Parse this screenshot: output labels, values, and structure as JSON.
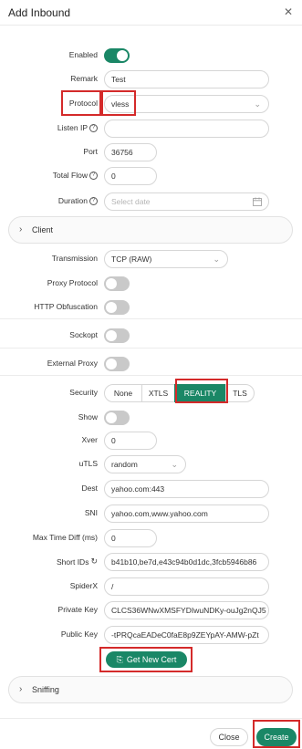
{
  "dialog": {
    "title": "Add Inbound",
    "close_icon": "close-icon"
  },
  "fields": {
    "enabled_label": "Enabled",
    "remark_label": "Remark",
    "remark_value": "Test",
    "protocol_label": "Protocol",
    "protocol_value": "vless",
    "listen_ip_label": "Listen IP",
    "port_label": "Port",
    "port_value": "36756",
    "total_flow_label": "Total Flow",
    "total_flow_value": "0",
    "duration_label": "Duration",
    "duration_placeholder": "Select date"
  },
  "client_section": {
    "label": "Client"
  },
  "stream": {
    "transmission_label": "Transmission",
    "transmission_value": "TCP (RAW)",
    "proxy_protocol_label": "Proxy Protocol",
    "http_obfuscation_label": "HTTP Obfuscation",
    "sockopt_label": "Sockopt",
    "external_proxy_label": "External Proxy"
  },
  "security": {
    "label": "Security",
    "options": [
      "None",
      "XTLS",
      "REALITY",
      "TLS"
    ],
    "selected": "REALITY"
  },
  "reality": {
    "show_label": "Show",
    "xver_label": "Xver",
    "xver_value": "0",
    "utls_label": "uTLS",
    "utls_value": "random",
    "dest_label": "Dest",
    "dest_value": "yahoo.com:443",
    "sni_label": "SNI",
    "sni_value": "yahoo.com,www.yahoo.com",
    "max_time_diff_label": "Max Time Diff (ms)",
    "max_time_diff_value": "0",
    "short_ids_label": "Short IDs",
    "short_ids_value": "b41b10,be7d,e43c94b0d1dc,3fcb5946b86",
    "spiderx_label": "SpiderX",
    "spiderx_value": "/",
    "private_key_label": "Private Key",
    "private_key_value": "CLCS36WNwXMSFYDIwuNDKy-ouJg2nQJ5",
    "public_key_label": "Public Key",
    "public_key_value": "-tPRQcaEADeC0faE8p9ZEYpAY-AMW-pZt",
    "get_new_cert_label": "Get New Cert"
  },
  "sniffing_section": {
    "label": "Sniffing"
  },
  "footer": {
    "close_label": "Close",
    "create_label": "Create"
  },
  "colors": {
    "accent": "#1a8766",
    "highlight": "#d42a2a"
  }
}
